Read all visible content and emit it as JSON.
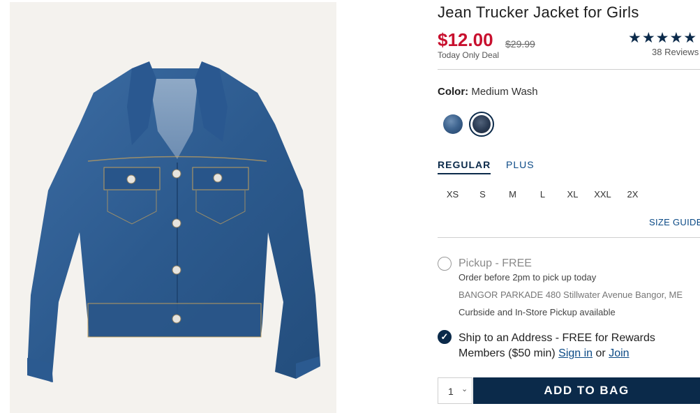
{
  "product": {
    "title": "Jean Trucker Jacket for Girls",
    "price": "$12.00",
    "original_price": "$29.99",
    "deal_label": "Today Only Deal",
    "rating_stars": "★★★★★",
    "reviews": "38 Reviews",
    "image_icon": "denim-jacket-image"
  },
  "color": {
    "label": "Color:",
    "value": "Medium Wash",
    "swatches": [
      "dark-wash-swatch",
      "medium-wash-swatch"
    ]
  },
  "fit_tabs": [
    "REGULAR",
    "PLUS"
  ],
  "sizes": [
    "XS",
    "S",
    "M",
    "L",
    "XL",
    "XXL",
    "2X"
  ],
  "size_guide": "SIZE GUIDE",
  "pickup": {
    "label": "Pickup - FREE",
    "order_note": "Order before 2pm to pick up today",
    "store": "BANGOR PARKADE 480 Stillwater Avenue  Bangor, ME",
    "note": "Curbside and In-Store Pickup available"
  },
  "ship": {
    "label_prefix": "Ship to an Address - FREE for Rewards Members ($50 min) ",
    "sign_in": "Sign in",
    "or": " or ",
    "join": "Join"
  },
  "bag": {
    "quantity": "1",
    "add_label": "ADD TO BAG"
  },
  "colors": {
    "price_red": "#c8102e",
    "navy": "#0b2a4a",
    "link_blue": "#0b4a86"
  }
}
